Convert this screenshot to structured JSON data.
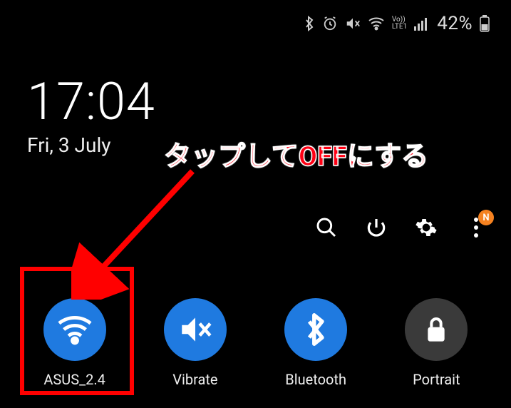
{
  "status": {
    "battery_pct": "42%",
    "network_label": "LTE1",
    "vo_label": "Vo))"
  },
  "clock": {
    "time": "17:04",
    "date": "Fri, 3 July"
  },
  "tools": {
    "more_badge": "N"
  },
  "quick_settings": [
    {
      "key": "wifi",
      "label": "ASUS_2.4",
      "state": "on"
    },
    {
      "key": "vibrate",
      "label": "Vibrate",
      "state": "on"
    },
    {
      "key": "bluetooth",
      "label": "Bluetooth",
      "state": "on"
    },
    {
      "key": "portrait",
      "label": "Portrait",
      "state": "off"
    }
  ],
  "annotation": {
    "text": "タップしてOFFにする"
  }
}
